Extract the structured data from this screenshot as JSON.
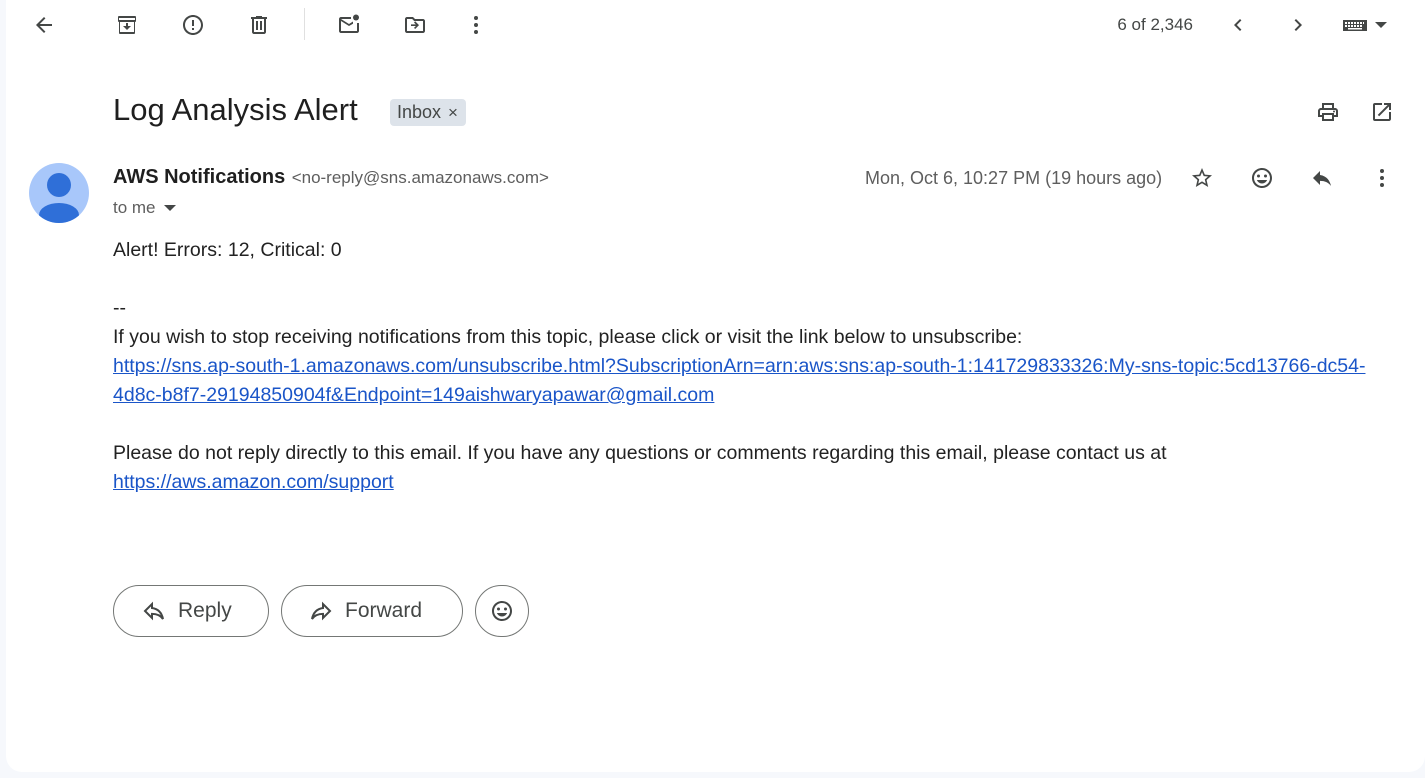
{
  "toolbar": {
    "back_icon": "arrow-back-icon",
    "archive_icon": "archive-icon",
    "report_icon": "report-spam-icon",
    "delete_icon": "delete-icon",
    "unread_icon": "mark-unread-icon",
    "move_icon": "move-to-icon",
    "more_icon": "more-vert-icon",
    "counter": "6 of 2,346",
    "prev_icon": "chevron-left-icon",
    "next_icon": "chevron-right-icon",
    "keyboard_icon": "keyboard-icon"
  },
  "message": {
    "subject": "Log Analysis Alert",
    "label": "Inbox",
    "label_remove": "×",
    "sender_name": "AWS Notifications",
    "sender_email": "<no-reply@sns.amazonaws.com>",
    "recipient": "to me",
    "date": "Mon, Oct 6, 10:27 PM (19 hours ago)"
  },
  "body": {
    "alert": "Alert! Errors: 12, Critical: 0",
    "separator": "--",
    "unsubscribe_text": "If you wish to stop receiving notifications from this topic, please click or visit the link below to unsubscribe:",
    "unsubscribe_link": "https://sns.ap-south-1.amazonaws.com/unsubscribe.html?SubscriptionArn=arn:aws:sns:ap-south-1:141729833326:My-sns-topic:5cd13766-dc54-4d8c-b8f7-29194850904f&Endpoint=149aishwaryapawar@gmail.com",
    "noreply_text": "Please do not reply directly to this email. If you have any questions or comments regarding this email, please contact us at",
    "support_link": "https://aws.amazon.com/support"
  },
  "actions": {
    "reply_label": "Reply",
    "forward_label": "Forward"
  },
  "colors": {
    "link": "#1a55c8",
    "avatar_bg": "#a8c7fa",
    "avatar_fg": "#2f6fd8",
    "chip_bg": "#dde3ea"
  }
}
